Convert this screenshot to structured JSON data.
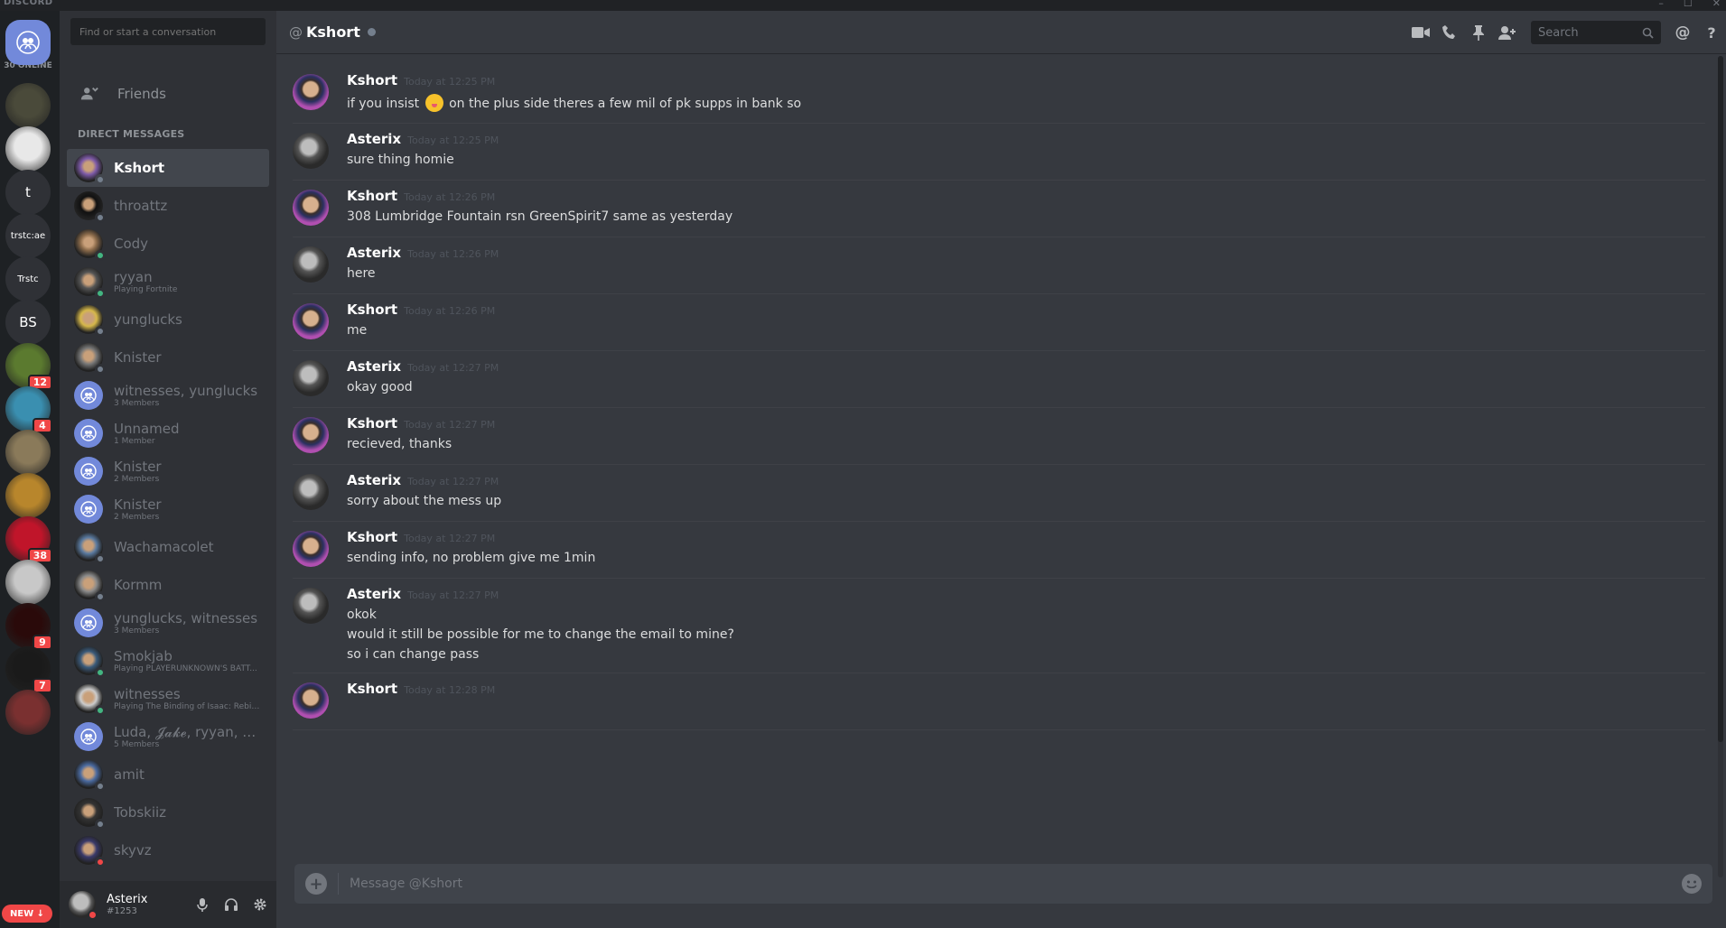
{
  "window": {
    "brand": "DISCORD"
  },
  "guilds": {
    "online_count": "30 ONLINE",
    "items": [
      {
        "name": "Friends",
        "kind": "home"
      },
      {
        "name": "server-1",
        "kind": "image",
        "color": "#4a4a3a"
      },
      {
        "name": "server-2",
        "kind": "image",
        "color": "#e8e8e8"
      },
      {
        "name": "t",
        "kind": "text",
        "label": "t"
      },
      {
        "name": "trstc:ae",
        "kind": "text",
        "label": "trstc:ae"
      },
      {
        "name": "Trstc",
        "kind": "text",
        "label": "Trstc"
      },
      {
        "name": "BS",
        "kind": "text",
        "label": "BS"
      },
      {
        "name": "server-8",
        "kind": "image",
        "color": "#5b7a2f",
        "badge": "12"
      },
      {
        "name": "server-9",
        "kind": "image",
        "color": "#3a8fb0",
        "badge": "4"
      },
      {
        "name": "server-10",
        "kind": "image",
        "color": "#8a7a5a"
      },
      {
        "name": "server-11",
        "kind": "image",
        "color": "#b8862c"
      },
      {
        "name": "server-12",
        "kind": "image",
        "color": "#c0152a",
        "badge": "38"
      },
      {
        "name": "server-13",
        "kind": "image",
        "color": "#c8c8c8"
      },
      {
        "name": "server-14",
        "kind": "image",
        "color": "#2a0a0a",
        "badge": "9"
      },
      {
        "name": "server-15",
        "kind": "image",
        "color": "#1a1a1a",
        "badge": "7"
      },
      {
        "name": "server-16",
        "kind": "image",
        "color": "#7a3030"
      }
    ],
    "new_label": "NEW"
  },
  "dms": {
    "search_placeholder": "Find or start a conversation",
    "friends_label": "Friends",
    "header": "DIRECT MESSAGES",
    "items": [
      {
        "name": "Kshort",
        "sub": "",
        "status": "offline",
        "active": true,
        "avatar": "#7d5aa8"
      },
      {
        "name": "throattz",
        "sub": "",
        "status": "offline",
        "avatar": "#111111"
      },
      {
        "name": "Cody",
        "sub": "",
        "status": "online",
        "avatar": "#8a6a4a"
      },
      {
        "name": "ryyan",
        "sub": "Playing Fortnite",
        "status": "online",
        "avatar": "#555555"
      },
      {
        "name": "yunglucks",
        "sub": "",
        "status": "offline",
        "avatar": "#d6b84a"
      },
      {
        "name": "Knister",
        "sub": "",
        "status": "offline",
        "avatar": "#777777"
      },
      {
        "name": "witnesses, yunglucks",
        "sub": "3 Members",
        "status": "",
        "group": true
      },
      {
        "name": "Unnamed",
        "sub": "1 Member",
        "status": "",
        "group": true
      },
      {
        "name": "Knister",
        "sub": "2 Members",
        "status": "",
        "group": true
      },
      {
        "name": "Knister",
        "sub": "2 Members",
        "status": "",
        "group": true
      },
      {
        "name": "Wachamacolet",
        "sub": "",
        "status": "offline",
        "avatar": "#5a7aa0"
      },
      {
        "name": "Kormm",
        "sub": "",
        "status": "offline",
        "avatar": "#8a8a8a"
      },
      {
        "name": "yunglucks, witnesses",
        "sub": "3 Members",
        "status": "",
        "group": true
      },
      {
        "name": "Smokjab",
        "sub": "Playing PLAYERUNKNOWN'S BATT...",
        "status": "online",
        "avatar": "#3a5a7a"
      },
      {
        "name": "witnesses",
        "sub": "Playing The Binding of Isaac: Rebirth",
        "status": "online",
        "avatar": "#cccccc"
      },
      {
        "name": "Luda, 𝓙𝓪𝓴𝓮, ryyan, kail...",
        "sub": "5 Members",
        "status": "",
        "group": true
      },
      {
        "name": "amit",
        "sub": "",
        "status": "offline",
        "avatar": "#4a6aa0"
      },
      {
        "name": "Tobskiiz",
        "sub": "",
        "status": "offline",
        "avatar": "#333333"
      },
      {
        "name": "skyvz",
        "sub": "",
        "status": "dnd",
        "avatar": "#3a3a6a"
      }
    ]
  },
  "user": {
    "name": "Asterix",
    "tag": "#1253"
  },
  "chat": {
    "channel_name": "Kshort",
    "search_placeholder": "Search",
    "composer_placeholder": "Message @Kshort",
    "messages": [
      {
        "author": "Kshort",
        "time": "Today at 12:25 PM",
        "lines": [
          "if you insist",
          "on the plus side theres a few mil of pk supps in bank so"
        ],
        "emoji": true
      },
      {
        "author": "Asterix",
        "time": "Today at 12:25 PM",
        "lines": [
          "sure thing homie"
        ]
      },
      {
        "author": "Kshort",
        "time": "Today at 12:26 PM",
        "lines": [
          "308 Lumbridge Fountain rsn GreenSpirit7 same as yesterday"
        ]
      },
      {
        "author": "Asterix",
        "time": "Today at 12:26 PM",
        "lines": [
          "here"
        ]
      },
      {
        "author": "Kshort",
        "time": "Today at 12:26 PM",
        "lines": [
          "me"
        ]
      },
      {
        "author": "Asterix",
        "time": "Today at 12:27 PM",
        "lines": [
          "okay good"
        ]
      },
      {
        "author": "Kshort",
        "time": "Today at 12:27 PM",
        "lines": [
          "recieved, thanks"
        ]
      },
      {
        "author": "Asterix",
        "time": "Today at 12:27 PM",
        "lines": [
          "sorry about the mess up"
        ]
      },
      {
        "author": "Kshort",
        "time": "Today at 12:27 PM",
        "lines": [
          "sending info, no problem give me 1min"
        ]
      },
      {
        "author": "Asterix",
        "time": "Today at 12:27 PM",
        "lines": [
          "okok",
          "would it still be possible for me to change the email to mine?",
          "so i can change pass"
        ]
      },
      {
        "author": "Kshort",
        "time": "Today at 12:28 PM",
        "lines": []
      }
    ]
  },
  "colors": {
    "accent": "#7289da",
    "online": "#43b581",
    "dnd": "#f04747",
    "offline": "#747f8d"
  }
}
